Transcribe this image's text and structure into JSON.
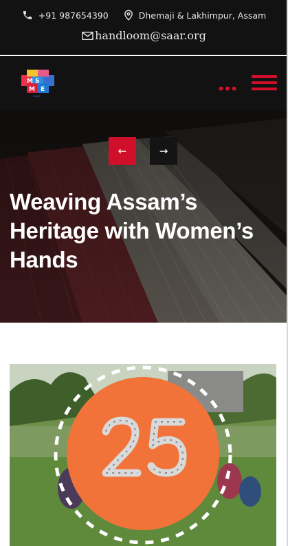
{
  "contact": {
    "phone": "+91 987654390",
    "location": "Dhemaji & Lakhimpur, Assam",
    "email": "handloom@saar.org"
  },
  "logo": {
    "letters": [
      "M",
      "S",
      "M",
      "E"
    ],
    "caption": "MSME"
  },
  "hero": {
    "title": "Weaving Assam’s Heritage with Women’s Hands",
    "prev_arrow": "←",
    "next_arrow": "→"
  },
  "badge": {
    "number": "25"
  },
  "colors": {
    "brand_red": "#d0102a",
    "dark": "#121212",
    "badge_orange": "#f2733a"
  },
  "icons": [
    "phone-icon",
    "location-pin-icon",
    "mail-icon",
    "more-dots-icon",
    "hamburger-menu-icon",
    "arrow-left-icon",
    "arrow-right-icon"
  ]
}
